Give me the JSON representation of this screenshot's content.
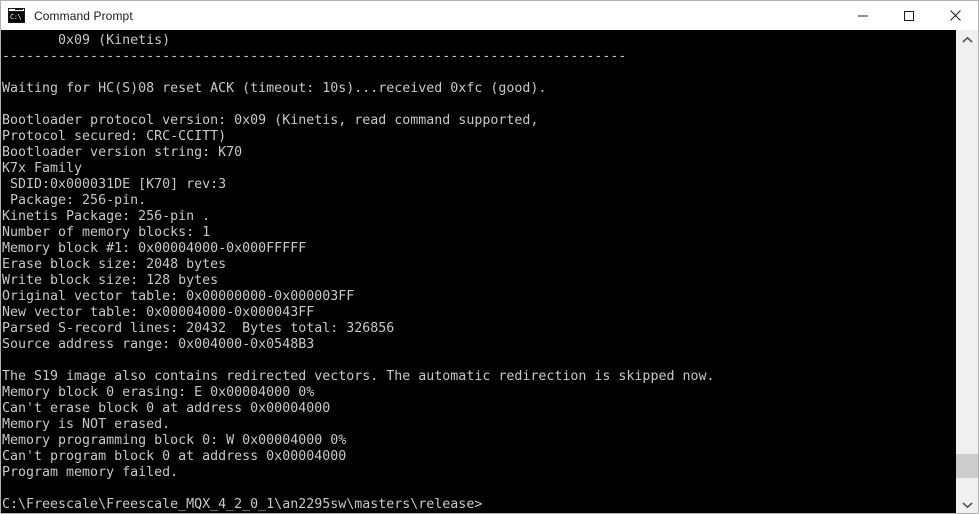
{
  "window": {
    "title": "Command Prompt",
    "icon": "command-prompt-icon",
    "icon_glyph": "C:\\",
    "colors": {
      "titlebar_bg": "#ffffff",
      "title_fg": "#1b1b1b",
      "console_bg": "#000000",
      "console_fg": "#c8c8c8",
      "scrollbar_track": "#f0f0f0",
      "scrollbar_thumb": "#cdcdcd",
      "window_border": "#b0b0b0"
    },
    "controls": [
      {
        "name": "minimize",
        "label": "—"
      },
      {
        "name": "maximize",
        "label": "☐"
      },
      {
        "name": "close",
        "label": "✕"
      }
    ]
  },
  "console": {
    "lines": [
      "       0x09 (Kinetis)",
      "------------------------------------------------------------------------------",
      "",
      "Waiting for HC(S)08 reset ACK (timeout: 10s)...received 0xfc (good).",
      "",
      "Bootloader protocol version: 0x09 (Kinetis, read command supported,",
      "Protocol secured: CRC-CCITT)",
      "Bootloader version string: K70",
      "K7x Family",
      " SDID:0x000031DE [K70] rev:3",
      " Package: 256-pin.",
      "Kinetis Package: 256-pin .",
      "Number of memory blocks: 1",
      "Memory block #1: 0x00004000-0x000FFFFF",
      "Erase block size: 2048 bytes",
      "Write block size: 128 bytes",
      "Original vector table: 0x00000000-0x000003FF",
      "New vector table: 0x00004000-0x000043FF",
      "Parsed S-record lines: 20432  Bytes total: 326856",
      "Source address range: 0x004000-0x0548B3",
      "",
      "The S19 image also contains redirected vectors. The automatic redirection is skipped now.",
      "Memory block 0 erasing: E 0x00004000 0%",
      "Can't erase block 0 at address 0x00004000",
      "Memory is NOT erased.",
      "Memory programming block 0: W 0x00004000 0%",
      "Can't program block 0 at address 0x00004000",
      "Program memory failed.",
      "",
      "C:\\Freescale\\Freescale_MQX_4_2_0_1\\an2295sw\\masters\\release>"
    ],
    "prompt": "C:\\Freescale\\Freescale_MQX_4_2_0_1\\an2295sw\\masters\\release>"
  },
  "scrollbar": {
    "up_arrow": "chevron-up-icon",
    "down_arrow": "chevron-down-icon",
    "thumb_position_percent": 96
  }
}
